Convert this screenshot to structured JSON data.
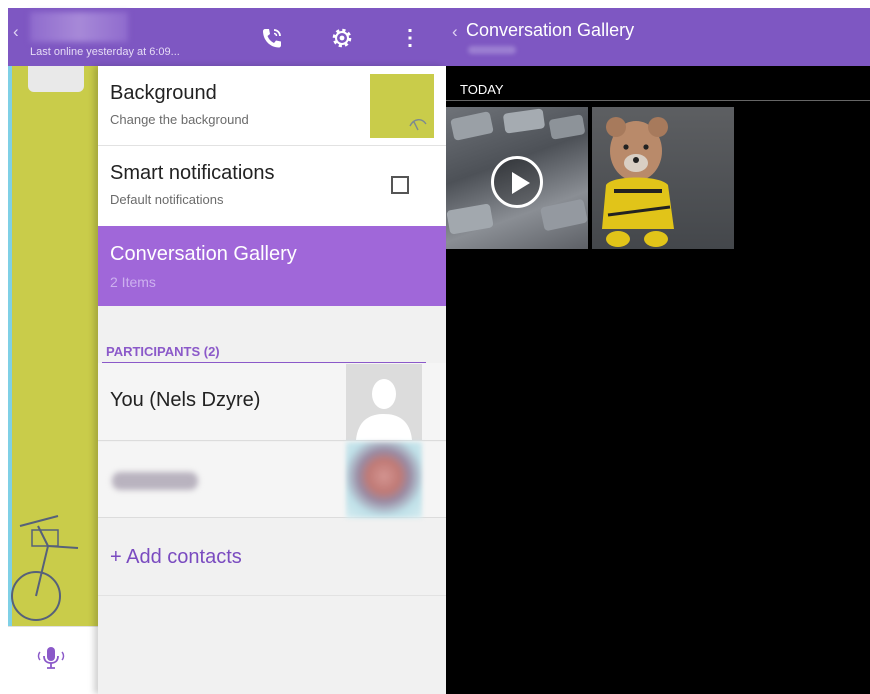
{
  "colors": {
    "accent": "#7e57c2",
    "selected_row": "#a067d9",
    "section_header": "#8b59c9",
    "gallery_bg": "#000000",
    "chat_bg": "#c9cc4a"
  },
  "chat": {
    "back_glyph": "‹",
    "status": "Last online yesterday at 6:09...",
    "icons": [
      "phone-icon",
      "gear-icon",
      "more-vert-icon"
    ]
  },
  "chat_input": {
    "icon": "mic-icon"
  },
  "info_panel": {
    "background": {
      "title": "Background",
      "subtitle": "Change the background"
    },
    "smart_notifications": {
      "title": "Smart notifications",
      "subtitle": "Default notifications",
      "checked": false
    },
    "conversation_gallery": {
      "title": "Conversation Gallery",
      "subtitle": "2 Items"
    },
    "participants_header": "PARTICIPANTS (2)",
    "participants": [
      {
        "name": "You (Nels Dzyre)"
      }
    ],
    "add_contacts": "+ Add contacts"
  },
  "gallery": {
    "back_glyph": "‹",
    "title": "Conversation Gallery",
    "section": "TODAY",
    "items": [
      {
        "type": "video"
      },
      {
        "type": "photo"
      }
    ]
  }
}
